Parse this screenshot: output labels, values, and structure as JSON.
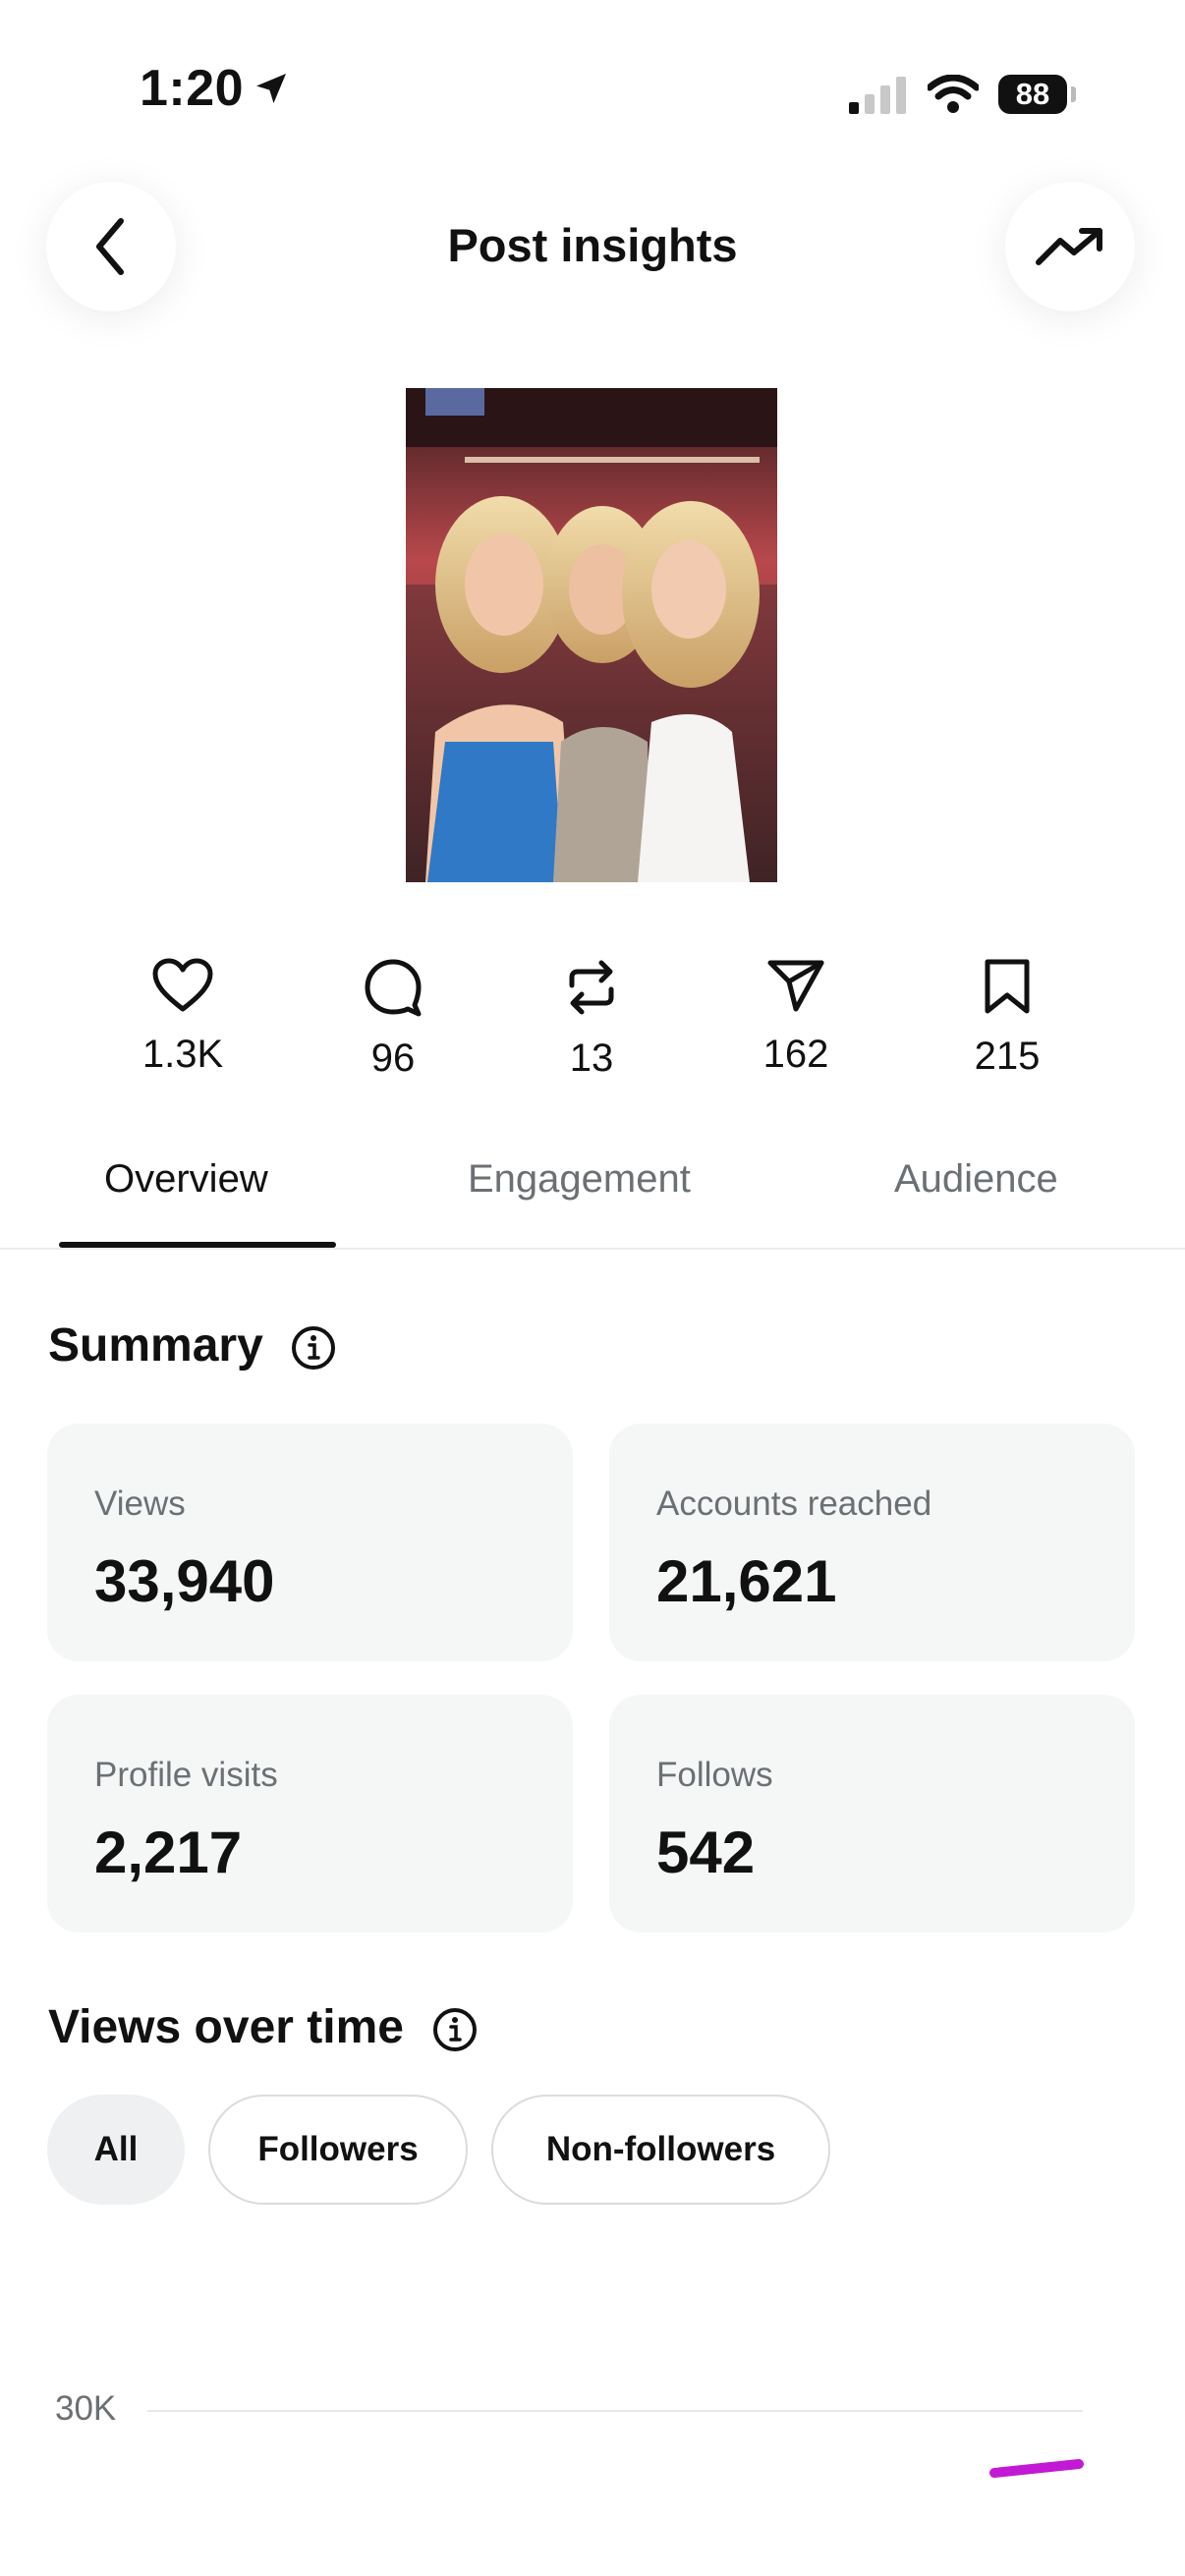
{
  "status_bar": {
    "time": "1:20",
    "battery": "88"
  },
  "header": {
    "title": "Post insights"
  },
  "post": {
    "image_alt": "Photo of three women at an arena event"
  },
  "stats": [
    {
      "icon": "heart-icon",
      "value": "1.3K"
    },
    {
      "icon": "comment-icon",
      "value": "96"
    },
    {
      "icon": "repost-icon",
      "value": "13"
    },
    {
      "icon": "share-icon",
      "value": "162"
    },
    {
      "icon": "bookmark-icon",
      "value": "215"
    }
  ],
  "tabs": [
    {
      "label": "Overview",
      "active": true
    },
    {
      "label": "Engagement",
      "active": false
    },
    {
      "label": "Audience",
      "active": false
    }
  ],
  "summary": {
    "title": "Summary",
    "cards": [
      {
        "label": "Views",
        "value": "33,940"
      },
      {
        "label": "Accounts reached",
        "value": "21,621"
      },
      {
        "label": "Profile visits",
        "value": "2,217"
      },
      {
        "label": "Follows",
        "value": "542"
      }
    ]
  },
  "views_over_time": {
    "title": "Views over time",
    "filters": [
      {
        "label": "All",
        "active": true
      },
      {
        "label": "Followers",
        "active": false
      },
      {
        "label": "Non-followers",
        "active": false
      }
    ]
  },
  "chart_data": {
    "type": "line",
    "title": "",
    "xlabel": "",
    "ylabel": "",
    "y_tick_labels": [
      "30K"
    ],
    "series_color": "#c21ad4"
  },
  "colors": {
    "accent_line": "#c21ad4",
    "card_bg": "#f5f6f6",
    "muted_text": "#6b7075"
  }
}
